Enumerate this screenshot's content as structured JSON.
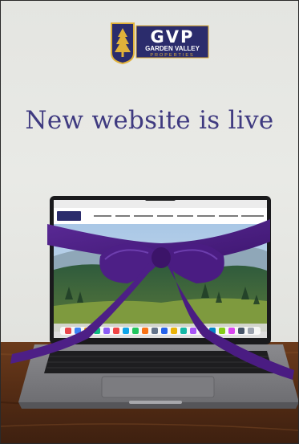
{
  "logo": {
    "initials": "GVP",
    "line1": "GARDEN VALLEY",
    "line2": "PROPERTIES",
    "icon": "pine-tree-icon"
  },
  "headline": "New website is live",
  "colors": {
    "wall": "#e6e7e3",
    "headline": "#3f3a80",
    "logo_navy": "#2b2c6c",
    "logo_gold": "#e0b13a",
    "ribbon": "#4d1f86",
    "table": "#5a2f16"
  }
}
